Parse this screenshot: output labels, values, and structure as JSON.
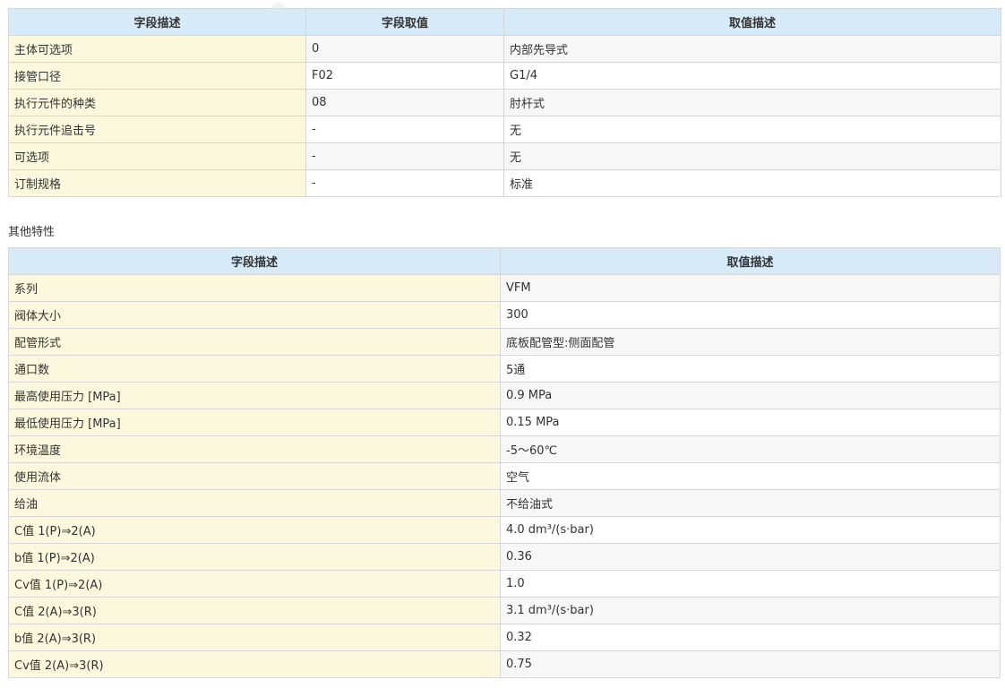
{
  "table1": {
    "headers": [
      "字段描述",
      "字段取值",
      "取值描述"
    ],
    "rows": [
      [
        "主体可选项",
        "0",
        "内部先导式"
      ],
      [
        "接管口径",
        "F02",
        "G1/4"
      ],
      [
        "执行元件的种类",
        "08",
        "肘杆式"
      ],
      [
        "执行元件追击号",
        "-",
        "无"
      ],
      [
        "可选项",
        "-",
        "无"
      ],
      [
        "订制规格",
        "-",
        "标准"
      ]
    ]
  },
  "section_title": "其他特性",
  "table2": {
    "headers": [
      "字段描述",
      "取值描述"
    ],
    "rows": [
      [
        "系列",
        "VFM"
      ],
      [
        "阀体大小",
        "300"
      ],
      [
        "配管形式",
        "底板配管型:侧面配管"
      ],
      [
        "通口数",
        "5通"
      ],
      [
        "最高使用压力 [MPa]",
        "0.9 MPa"
      ],
      [
        "最低使用压力 [MPa]",
        "0.15 MPa"
      ],
      [
        "环境温度",
        "-5～60℃"
      ],
      [
        "使用流体",
        "空气"
      ],
      [
        "给油",
        "不给油式"
      ],
      [
        "C值 1(P)⇒2(A)",
        "4.0 dm³/(s·bar)"
      ],
      [
        "b值 1(P)⇒2(A)",
        "0.36"
      ],
      [
        "Cv值 1(P)⇒2(A)",
        "1.0"
      ],
      [
        "C值 2(A)⇒3(R)",
        "3.1 dm³/(s·bar)"
      ],
      [
        "b值 2(A)⇒3(R)",
        "0.32"
      ],
      [
        "Cv值 2(A)⇒3(R)",
        "0.75"
      ]
    ]
  },
  "watermark": "chem17.com"
}
